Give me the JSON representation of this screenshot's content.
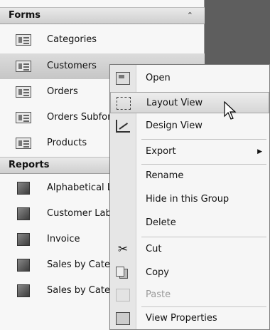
{
  "nav": {
    "forms_header": "Forms",
    "collapse_glyph": "⌃",
    "forms": [
      "Categories",
      "Customers",
      "Orders",
      "Orders Subform",
      "Products"
    ],
    "reports_header": "Reports",
    "reports": [
      "Alphabetical List of Products",
      "Customer Labels",
      "Invoice",
      "Sales by Category",
      "Sales by Category Subreport"
    ]
  },
  "context_menu": {
    "open": "Open",
    "layout_view": "Layout View",
    "design_view": "Design View",
    "export": "Export",
    "submenu_arrow": "▶",
    "rename": "Rename",
    "hide": "Hide in this Group",
    "delete": "Delete",
    "cut": "Cut",
    "cut_glyph": "✂",
    "copy": "Copy",
    "paste": "Paste",
    "view_properties": "View Properties"
  }
}
